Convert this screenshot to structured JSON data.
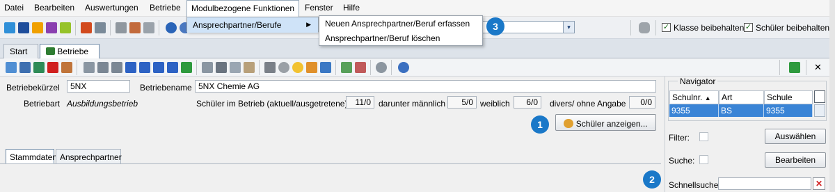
{
  "menubar": {
    "items": [
      "Datei",
      "Bearbeiten",
      "Auswertungen",
      "Betriebe",
      "Modulbezogene Funktionen",
      "Fenster",
      "Hilfe"
    ]
  },
  "submenu": {
    "item": "Ansprechpartner/Berufe",
    "arrow": "▶"
  },
  "flyout": {
    "items": [
      "Neuen Ansprechpartner/Beruf erfassen",
      "Ansprechpartner/Beruf löschen"
    ]
  },
  "badges": [
    "1",
    "2",
    "3"
  ],
  "toolbar1": {
    "combo_arrow": "▾",
    "keep_class": "Klasse beibehalten",
    "keep_student": "Schüler beibehalten",
    "check_mark": "✓"
  },
  "tabs": [
    {
      "label": "Start",
      "close": "✕"
    },
    {
      "label": "Betriebe",
      "close": "✕"
    }
  ],
  "toolbar2": {
    "close": "✕"
  },
  "form": {
    "short_label": "Betriebekürzel",
    "short_value": "5NX",
    "name_label": "Betriebename",
    "name_value": "5NX Chemie AG",
    "type_label": "Betriebart",
    "type_value": "Ausbildungsbetrieb",
    "students_label": "Schüler im Betrieb (aktuell/ausgetretene)",
    "students_value": "11/0",
    "male_label": "darunter männlich",
    "male_value": "5/0",
    "female_label": "weiblich",
    "female_value": "6/0",
    "divers_label": "divers/ ohne Angabe",
    "divers_value": "0/0",
    "show_students_button": "Schüler anzeigen..."
  },
  "bottom_tabs": [
    "Stammdaten",
    "Ansprechpartner"
  ],
  "navigator": {
    "title": "Navigator",
    "columns": [
      "Schulnr.",
      "Art",
      "Schule"
    ],
    "sort_arrow": "▲",
    "row": [
      "9355",
      "BS",
      "9355"
    ],
    "filter_label": "Filter:",
    "select_button": "Auswählen",
    "search_label": "Suche:",
    "edit_button": "Bearbeiten",
    "quick_search_label": "Schnellsuche",
    "quick_search_value": "",
    "clear_icon": "✕"
  },
  "colors": {
    "accent": "#1a78c8",
    "selection": "#3a84d6",
    "clear_red": "#d02020"
  }
}
